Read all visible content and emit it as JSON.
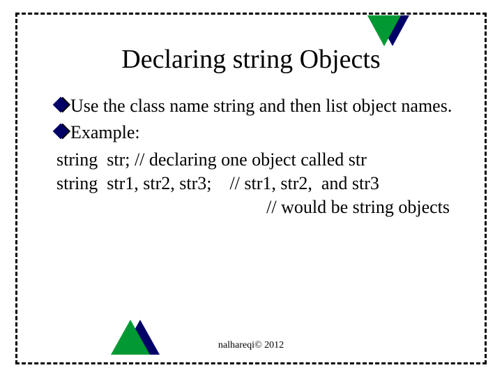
{
  "title": "Declaring string Objects",
  "bullets": {
    "b1_pre": "Use the class name ",
    "b1_keyword": "string",
    "b1_post": " and then list object names.",
    "b2": "Example:"
  },
  "code": {
    "line1": "string  str; // declaring one object called str",
    "line2": "string  str1, str2, str3;    // str1, str2,  and str3",
    "line3": "// would be string objects"
  },
  "footer": "nalhareqi© 2012"
}
